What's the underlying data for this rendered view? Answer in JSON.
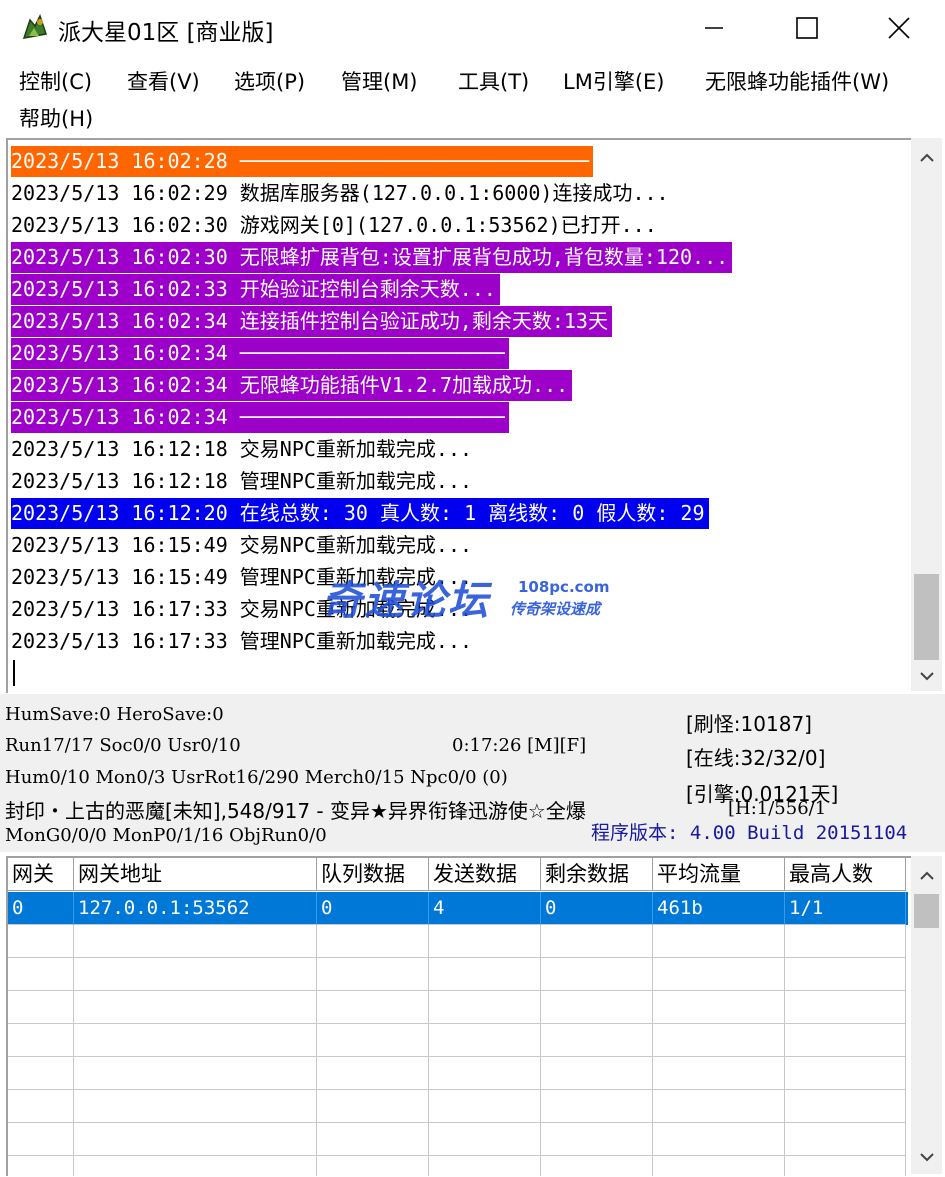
{
  "window": {
    "title": "派大星01区 [商业版]",
    "app_icon": "game-app-icon",
    "controls": [
      "minimize-icon",
      "maximize-icon",
      "close-icon"
    ]
  },
  "menu": [
    "控制(C)",
    "查看(V)",
    "选项(P)",
    "管理(M)",
    "工具(T)",
    "LM引擎(E)",
    "无限蜂功能插件(W)",
    "帮助(H)"
  ],
  "log": [
    {
      "time": "2023/5/13 16:02:28",
      "text": "─────────────────────────────",
      "style": "orange"
    },
    {
      "time": "2023/5/13 16:02:29",
      "text": "数据库服务器(127.0.0.1:6000)连接成功...",
      "style": "normal"
    },
    {
      "time": "2023/5/13 16:02:30",
      "text": "游戏网关[0](127.0.0.1:53562)已打开...",
      "style": "normal"
    },
    {
      "time": "2023/5/13 16:02:30",
      "text": "无限蜂扩展背包:设置扩展背包成功,背包数量:120...",
      "style": "purple"
    },
    {
      "time": "2023/5/13 16:02:33",
      "text": "开始验证控制台剩余天数...",
      "style": "purple"
    },
    {
      "time": "2023/5/13 16:02:34",
      "text": "连接插件控制台验证成功,剩余天数:13天",
      "style": "purple"
    },
    {
      "time": "2023/5/13 16:02:34",
      "text": "──────────────────────",
      "style": "purple"
    },
    {
      "time": "2023/5/13 16:02:34",
      "text": "无限蜂功能插件V1.2.7加载成功...",
      "style": "purple"
    },
    {
      "time": "2023/5/13 16:02:34",
      "text": "──────────────────────",
      "style": "purple"
    },
    {
      "time": "2023/5/13 16:12:18",
      "text": "交易NPC重新加载完成...",
      "style": "normal"
    },
    {
      "time": "2023/5/13 16:12:18",
      "text": "管理NPC重新加载完成...",
      "style": "normal"
    },
    {
      "time": "2023/5/13 16:12:20",
      "text": "在线总数: 30 真人数: 1 离线数: 0 假人数: 29",
      "style": "blue"
    },
    {
      "time": "2023/5/13 16:15:49",
      "text": "交易NPC重新加载完成...",
      "style": "normal"
    },
    {
      "time": "2023/5/13 16:15:49",
      "text": "管理NPC重新加载完成...",
      "style": "normal"
    },
    {
      "time": "2023/5/13 16:17:33",
      "text": "交易NPC重新加载完成...",
      "style": "normal"
    },
    {
      "time": "2023/5/13 16:17:33",
      "text": "管理NPC重新加载完成...",
      "style": "normal"
    }
  ],
  "status": {
    "line1": "HumSave:0 HeroSave:0",
    "line2": "Run17/17 Soc0/0 Usr0/10",
    "runtime": "0:17:26 [M][F]",
    "line3": "Hum0/10 Mon0/3 UsrRot16/290 Merch0/15 Npc0/0 (0)",
    "line4": "封印・上古的恶魔[未知],548/917 - 变异★异界衔锋迅游使☆全爆",
    "line4_tail": "[H:1/556/1",
    "line5": "MonG0/0/0 MonP0/1/16 ObjRun0/0",
    "refresh": "[刷怪:10187]",
    "online": "[在线:32/32/0]",
    "engine": "[引擎:0.0121天]",
    "version": "程序版本: 4.00 Build 20151104"
  },
  "watermark": {
    "big": "奇速论坛",
    "url": "108pc.com",
    "sub": "传奇架设速成"
  },
  "table": {
    "headers": [
      "网关",
      "网关地址",
      "队列数据",
      "发送数据",
      "剩余数据",
      "平均流量",
      "最高人数"
    ],
    "rows": [
      [
        "0",
        "127.0.0.1:53562",
        "0",
        "4",
        "0",
        "461b",
        "1/1"
      ]
    ]
  }
}
